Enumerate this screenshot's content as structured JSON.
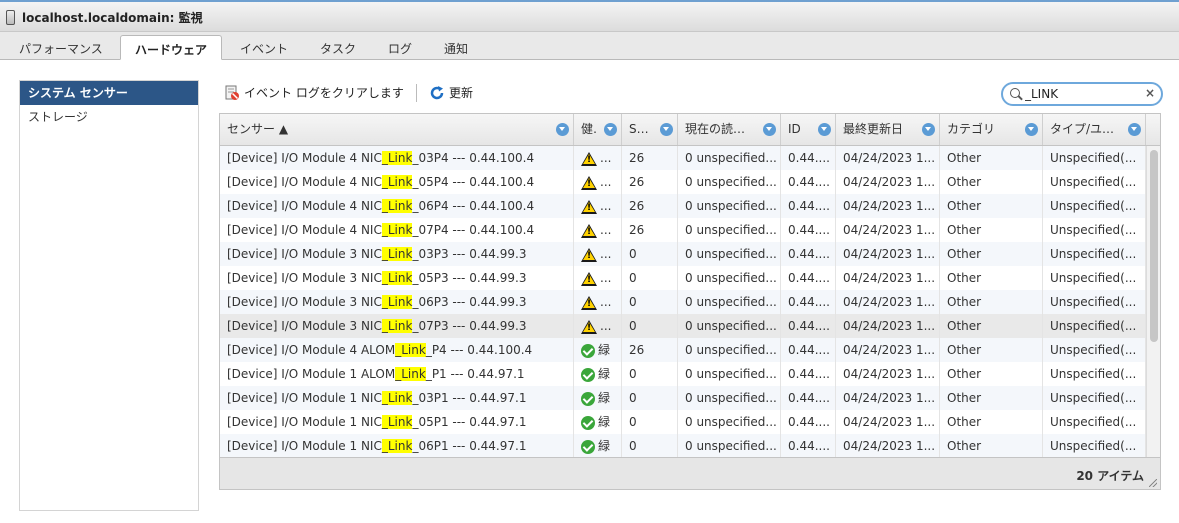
{
  "window": {
    "title": "localhost.localdomain: 監視"
  },
  "tabs": [
    "パフォーマンス",
    "ハードウェア",
    "イベント",
    "タスク",
    "ログ",
    "通知"
  ],
  "sidebar": {
    "items": [
      "システム センサー",
      "ストレージ"
    ]
  },
  "toolbar": {
    "clear_label": "イベント ログをクリアします",
    "refresh_label": "更新"
  },
  "search": {
    "value": "_LINK"
  },
  "grid": {
    "columns": [
      "センサー ▲",
      "健...",
      "SE...",
      "現在の読み...",
      "ID",
      "最終更新日",
      "カテゴリ",
      "タイプ/ユニ..."
    ],
    "rows": [
      {
        "pre": "[Device] I/O Module 4 NIC",
        "hl": "_Link",
        "post": "_03P4 --- 0.44.100.4",
        "status": "warning",
        "health": "...",
        "se": "26",
        "reading": "0 unspecified...",
        "id": "0.44....",
        "date": "04/24/2023 1...",
        "cat": "Other",
        "type": "Unspecified(..."
      },
      {
        "pre": "[Device] I/O Module 4 NIC",
        "hl": "_Link",
        "post": "_05P4 --- 0.44.100.4",
        "status": "warning",
        "health": "...",
        "se": "26",
        "reading": "0 unspecified...",
        "id": "0.44....",
        "date": "04/24/2023 1...",
        "cat": "Other",
        "type": "Unspecified(..."
      },
      {
        "pre": "[Device] I/O Module 4 NIC",
        "hl": "_Link",
        "post": "_06P4 --- 0.44.100.4",
        "status": "warning",
        "health": "...",
        "se": "26",
        "reading": "0 unspecified...",
        "id": "0.44....",
        "date": "04/24/2023 1...",
        "cat": "Other",
        "type": "Unspecified(..."
      },
      {
        "pre": "[Device] I/O Module 4 NIC",
        "hl": "_Link",
        "post": "_07P4 --- 0.44.100.4",
        "status": "warning",
        "health": "...",
        "se": "26",
        "reading": "0 unspecified...",
        "id": "0.44....",
        "date": "04/24/2023 1...",
        "cat": "Other",
        "type": "Unspecified(..."
      },
      {
        "pre": "[Device] I/O Module 3 NIC",
        "hl": "_Link",
        "post": "_03P3 --- 0.44.99.3",
        "status": "warning",
        "health": "...",
        "se": "0",
        "reading": "0 unspecified...",
        "id": "0.44....",
        "date": "04/24/2023 1...",
        "cat": "Other",
        "type": "Unspecified(..."
      },
      {
        "pre": "[Device] I/O Module 3 NIC",
        "hl": "_Link",
        "post": "_05P3 --- 0.44.99.3",
        "status": "warning",
        "health": "...",
        "se": "0",
        "reading": "0 unspecified...",
        "id": "0.44....",
        "date": "04/24/2023 1...",
        "cat": "Other",
        "type": "Unspecified(..."
      },
      {
        "pre": "[Device] I/O Module 3 NIC",
        "hl": "_Link",
        "post": "_06P3 --- 0.44.99.3",
        "status": "warning",
        "health": "...",
        "se": "0",
        "reading": "0 unspecified...",
        "id": "0.44....",
        "date": "04/24/2023 1...",
        "cat": "Other",
        "type": "Unspecified(..."
      },
      {
        "pre": "[Device] I/O Module 3 NIC",
        "hl": "_Link",
        "post": "_07P3 --- 0.44.99.3",
        "status": "warning",
        "health": "...",
        "se": "0",
        "reading": "0 unspecified...",
        "id": "0.44....",
        "date": "04/24/2023 1...",
        "cat": "Other",
        "type": "Unspecified(..."
      },
      {
        "pre": "[Device] I/O Module 4 ALOM",
        "hl": "_Link",
        "post": "_P4 --- 0.44.100.4",
        "status": "ok",
        "health": "緑",
        "se": "26",
        "reading": "0 unspecified...",
        "id": "0.44....",
        "date": "04/24/2023 1...",
        "cat": "Other",
        "type": "Unspecified(..."
      },
      {
        "pre": "[Device] I/O Module 1 ALOM",
        "hl": "_Link",
        "post": "_P1 --- 0.44.97.1",
        "status": "ok",
        "health": "緑",
        "se": "0",
        "reading": "0 unspecified...",
        "id": "0.44....",
        "date": "04/24/2023 1...",
        "cat": "Other",
        "type": "Unspecified(..."
      },
      {
        "pre": "[Device] I/O Module 1 NIC",
        "hl": "_Link",
        "post": "_03P1 --- 0.44.97.1",
        "status": "ok",
        "health": "緑",
        "se": "0",
        "reading": "0 unspecified...",
        "id": "0.44....",
        "date": "04/24/2023 1...",
        "cat": "Other",
        "type": "Unspecified(..."
      },
      {
        "pre": "[Device] I/O Module 1 NIC",
        "hl": "_Link",
        "post": "_05P1 --- 0.44.97.1",
        "status": "ok",
        "health": "緑",
        "se": "0",
        "reading": "0 unspecified...",
        "id": "0.44....",
        "date": "04/24/2023 1...",
        "cat": "Other",
        "type": "Unspecified(..."
      },
      {
        "pre": "[Device] I/O Module 1 NIC",
        "hl": "_Link",
        "post": "_06P1 --- 0.44.97.1",
        "status": "ok",
        "health": "緑",
        "se": "0",
        "reading": "0 unspecified...",
        "id": "0.44....",
        "date": "04/24/2023 1...",
        "cat": "Other",
        "type": "Unspecified(..."
      }
    ],
    "item_count": "20 アイテム"
  }
}
